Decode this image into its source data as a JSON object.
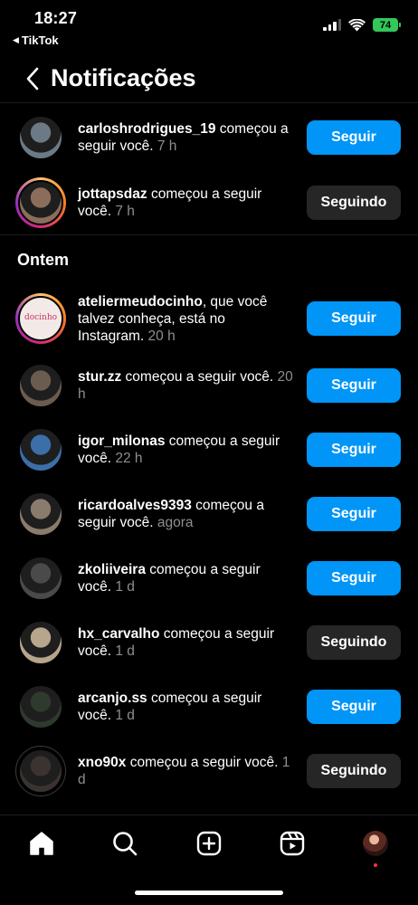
{
  "status_bar": {
    "time": "18:27",
    "back_app": "TikTok",
    "battery": "74"
  },
  "header": {
    "title": "Notificações"
  },
  "section_yesterday": "Ontem",
  "notifications": [
    {
      "username": "carloshrodrigues_19",
      "text": " começou a seguir você.",
      "time": " 7 h",
      "button": "Seguir",
      "button_type": "follow",
      "ring": "none",
      "avatar_color": "#6b7a84"
    },
    {
      "username": "jottapsdaz",
      "text": " começou a seguir você.",
      "time": " 7 h",
      "button": "Seguindo",
      "button_type": "following",
      "ring": "story",
      "avatar_color": "#8b6d5c"
    },
    {
      "username": "ateliermeudocinho",
      "text": ", que você talvez conheça, está no Instagram.",
      "time": " 20 h",
      "button": "Seguir",
      "button_type": "follow",
      "ring": "story",
      "avatar_color": "#f3e9e6",
      "avatar_label": "docinho"
    },
    {
      "username": "stur.zz",
      "text": " começou a seguir você.",
      "time": " 20 h",
      "button": "Seguir",
      "button_type": "follow",
      "ring": "none",
      "avatar_color": "#6a5d50"
    },
    {
      "username": "igor_milonas",
      "text": " começou a seguir você.",
      "time": " 22 h",
      "button": "Seguir",
      "button_type": "follow",
      "ring": "none",
      "avatar_color": "#3b6fa8"
    },
    {
      "username": "ricardoalves9393",
      "text": " começou a seguir você.",
      "time": " agora",
      "button": "Seguir",
      "button_type": "follow",
      "ring": "none",
      "avatar_color": "#8a7c6c"
    },
    {
      "username": "zkoliiveira",
      "text": " começou a seguir você.",
      "time": " 1 d",
      "button": "Seguir",
      "button_type": "follow",
      "ring": "none",
      "avatar_color": "#4a4a4a"
    },
    {
      "username": "hx_carvalho",
      "text": " começou a seguir você.",
      "time": " 1 d",
      "button": "Seguindo",
      "button_type": "following",
      "ring": "none",
      "avatar_color": "#b7a58c"
    },
    {
      "username": "arcanjo.ss",
      "text": " começou a seguir você.",
      "time": " 1 d",
      "button": "Seguir",
      "button_type": "follow",
      "ring": "none",
      "avatar_color": "#2f3a2e"
    },
    {
      "username": "xno90x",
      "text": " começou a seguir você.",
      "time": " 1 d",
      "button": "Seguindo",
      "button_type": "following",
      "ring": "seen",
      "avatar_color": "#3a3330"
    }
  ],
  "bottom_nav": [
    {
      "name": "home",
      "icon": "home-icon"
    },
    {
      "name": "search",
      "icon": "search-icon"
    },
    {
      "name": "create",
      "icon": "plus-square-icon"
    },
    {
      "name": "reels",
      "icon": "reels-icon"
    },
    {
      "name": "profile",
      "icon": "profile-avatar"
    }
  ],
  "colors": {
    "accent": "#0095f6",
    "following_bg": "#262626",
    "muted_text": "#8e8e8e",
    "notification_dot": "#ff3040"
  }
}
